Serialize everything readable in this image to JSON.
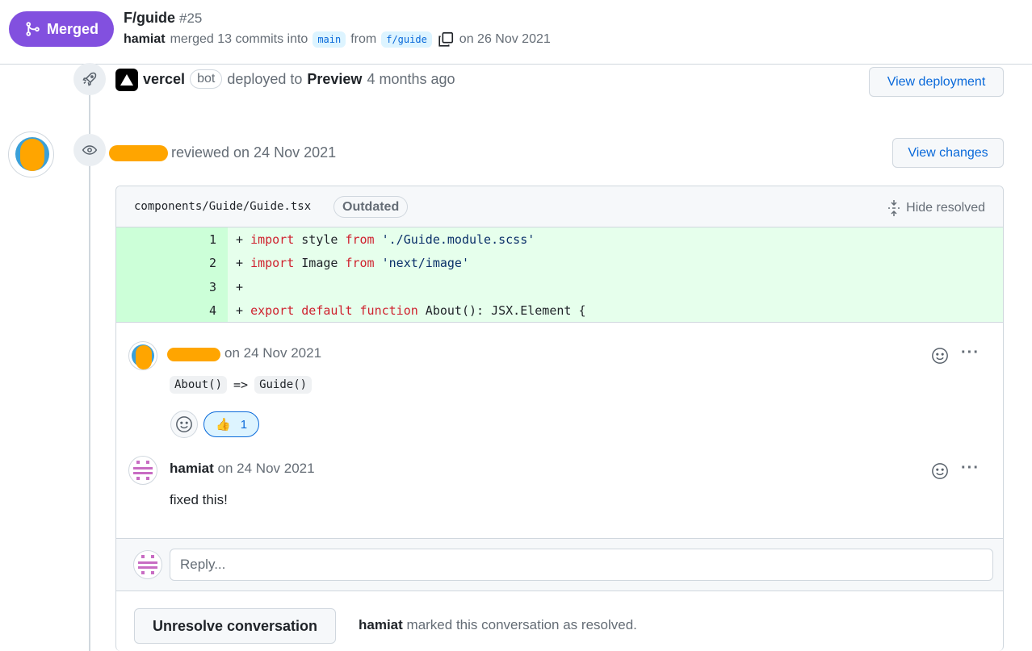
{
  "header": {
    "status_label": "Merged",
    "title": "F/guide",
    "number": "#25",
    "author": "hamiat",
    "merged_text": "merged 13 commits into",
    "base_branch": "main",
    "from_text": "from",
    "head_branch": "f/guide",
    "date_text": "on 26 Nov 2021"
  },
  "deployment": {
    "actor": "vercel",
    "bot_label": "bot",
    "action_text": "deployed to",
    "environment": "Preview",
    "time_text": "4 months ago",
    "button_label": "View deployment"
  },
  "review": {
    "action_text": "reviewed on 24 Nov 2021",
    "button_label": "View changes",
    "file": {
      "path": "components/Guide/Guide.tsx",
      "outdated_label": "Outdated",
      "hide_resolved_label": "Hide resolved",
      "lines": [
        {
          "num": "1",
          "parts": [
            [
              "+ ",
              ""
            ],
            [
              "import",
              "kw"
            ],
            [
              " style ",
              ""
            ],
            [
              "from",
              "kw"
            ],
            [
              " ",
              ""
            ],
            [
              "'./Guide.module.scss'",
              "str"
            ]
          ]
        },
        {
          "num": "2",
          "parts": [
            [
              "+ ",
              ""
            ],
            [
              "import",
              "kw"
            ],
            [
              " Image ",
              ""
            ],
            [
              "from",
              "kw"
            ],
            [
              " ",
              ""
            ],
            [
              "'next/image'",
              "str"
            ]
          ]
        },
        {
          "num": "3",
          "parts": [
            [
              "+ ",
              ""
            ]
          ]
        },
        {
          "num": "4",
          "parts": [
            [
              "+ ",
              ""
            ],
            [
              "export",
              "kw"
            ],
            [
              " ",
              ""
            ],
            [
              "default",
              "kw"
            ],
            [
              " ",
              ""
            ],
            [
              "function",
              "kw"
            ],
            [
              " About(): JSX.Element {",
              ""
            ]
          ]
        }
      ]
    },
    "comments": [
      {
        "date_text": "on 24 Nov 2021",
        "code_a": "About()",
        "arrow": "=>",
        "code_b": "Guide()",
        "reaction_emoji": "👍",
        "reaction_count": "1"
      },
      {
        "author": "hamiat",
        "date_text": "on 24 Nov 2021",
        "body": "fixed this!"
      }
    ],
    "reply_placeholder": "Reply...",
    "unresolve_label": "Unresolve conversation",
    "resolved_by": "hamiat",
    "resolved_text": "marked this conversation as resolved."
  },
  "colors": {
    "merged": "#8250df",
    "link": "#0969da",
    "added_bg": "#e6ffec",
    "redaction": "#ffa500"
  }
}
